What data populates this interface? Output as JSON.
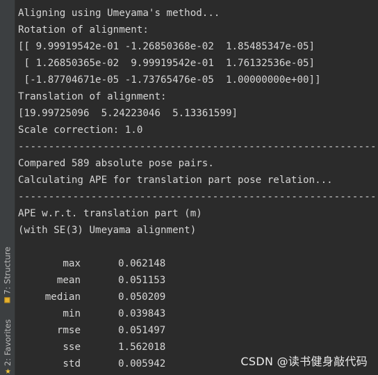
{
  "sidebar": {
    "structure_tab": {
      "prefix": "7: ",
      "label": "Structure",
      "icon": "structure-icon"
    },
    "favorites_tab": {
      "prefix": "2: ",
      "label": "Favorites",
      "icon": "star-icon"
    }
  },
  "console": {
    "lines_top": [
      "Aligning using Umeyama's method...",
      "Rotation of alignment:",
      "[[ 9.99919542e-01 -1.26850368e-02  1.85485347e-05]",
      " [ 1.26850365e-02  9.99919542e-01  1.76132536e-05]",
      " [-1.87704671e-05 -1.73765476e-05  1.00000000e+00]]",
      "Translation of alignment:",
      "[19.99725096  5.24223046  5.13361599]",
      "Scale correction: 1.0"
    ],
    "separator": "-----------------------------------------------------------------------------------",
    "lines_mid": [
      "Compared 589 absolute pose pairs.",
      "Calculating APE for translation part pose relation..."
    ],
    "lines_bottom": [
      "APE w.r.t. translation part (m)",
      "(with SE(3) Umeyama alignment)"
    ],
    "stats": [
      {
        "name": "max",
        "value": "0.062148"
      },
      {
        "name": "mean",
        "value": "0.051153"
      },
      {
        "name": "median",
        "value": "0.050209"
      },
      {
        "name": "min",
        "value": "0.039843"
      },
      {
        "name": "rmse",
        "value": "0.051497"
      },
      {
        "name": "sse",
        "value": "1.562018"
      },
      {
        "name": "std",
        "value": "0.005942"
      }
    ]
  },
  "watermark": "CSDN @读书健身敲代码"
}
